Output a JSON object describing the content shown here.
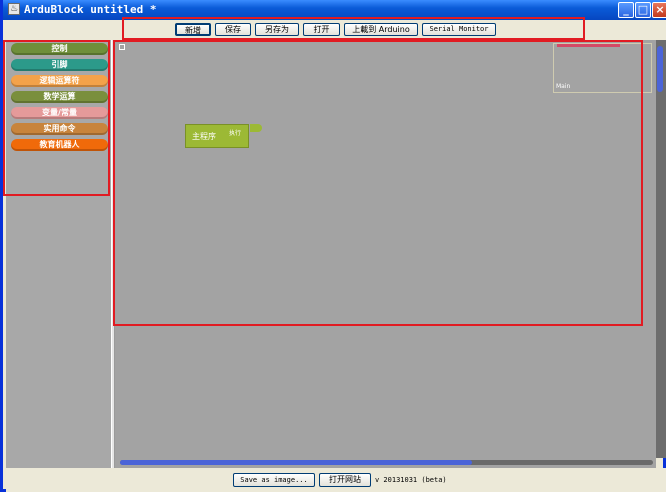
{
  "window": {
    "title": "ArduBlock untitled *",
    "icon_name": "app-icon",
    "controls": {
      "minimize": "_",
      "maximize": "□",
      "close": "×"
    }
  },
  "toolbar": {
    "new_label": "新增",
    "save_label": "保存",
    "save_as_label": "另存为",
    "open_label": "打开",
    "upload_label": "上載到 Arduino",
    "serial_monitor_label": "Serial Monitor"
  },
  "palette": {
    "categories": [
      {
        "label": "控制",
        "color": "#6f8f3a"
      },
      {
        "label": "引脚",
        "color": "#2c9a8a"
      },
      {
        "label": "逻辑运算符",
        "color": "#f3a24a"
      },
      {
        "label": "数学运算",
        "color": "#7a8f3d"
      },
      {
        "label": "变量/常量",
        "color": "#e59a9a"
      },
      {
        "label": "实用命令",
        "color": "#c8843c"
      },
      {
        "label": "教育机器人",
        "color": "#f06a0a"
      }
    ]
  },
  "canvas": {
    "block": {
      "title": "主程序",
      "slot_label": "执行",
      "color": "#9cb935"
    },
    "minimap_label": "Main",
    "hscroll_position": 0.66
  },
  "statusbar": {
    "save_image_label": "Save as image...",
    "open_website_label": "打开网站",
    "version": "v 20131031  (beta)"
  },
  "colors": {
    "highlight": "#e11b22",
    "canvas_bg": "#a3a3a3",
    "scroll_thumb": "#4b64d8"
  }
}
